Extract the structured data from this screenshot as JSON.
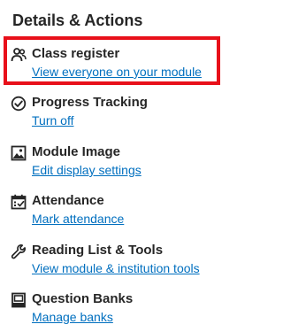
{
  "panel": {
    "title": "Details & Actions",
    "highlight_color": "#e8101a",
    "link_color": "#006fbf",
    "items": [
      {
        "title": "Class register",
        "link": "View everyone on your module",
        "icon": "people-icon"
      },
      {
        "title": "Progress Tracking",
        "link": "Turn off",
        "icon": "check-circle-icon"
      },
      {
        "title": "Module Image",
        "link": "Edit display settings",
        "icon": "image-icon"
      },
      {
        "title": "Attendance",
        "link": "Mark attendance",
        "icon": "calendar-check-icon"
      },
      {
        "title": "Reading List & Tools",
        "link": "View module & institution tools",
        "icon": "wrench-icon"
      },
      {
        "title": "Question Banks",
        "link": "Manage banks",
        "icon": "question-bank-icon"
      }
    ]
  }
}
